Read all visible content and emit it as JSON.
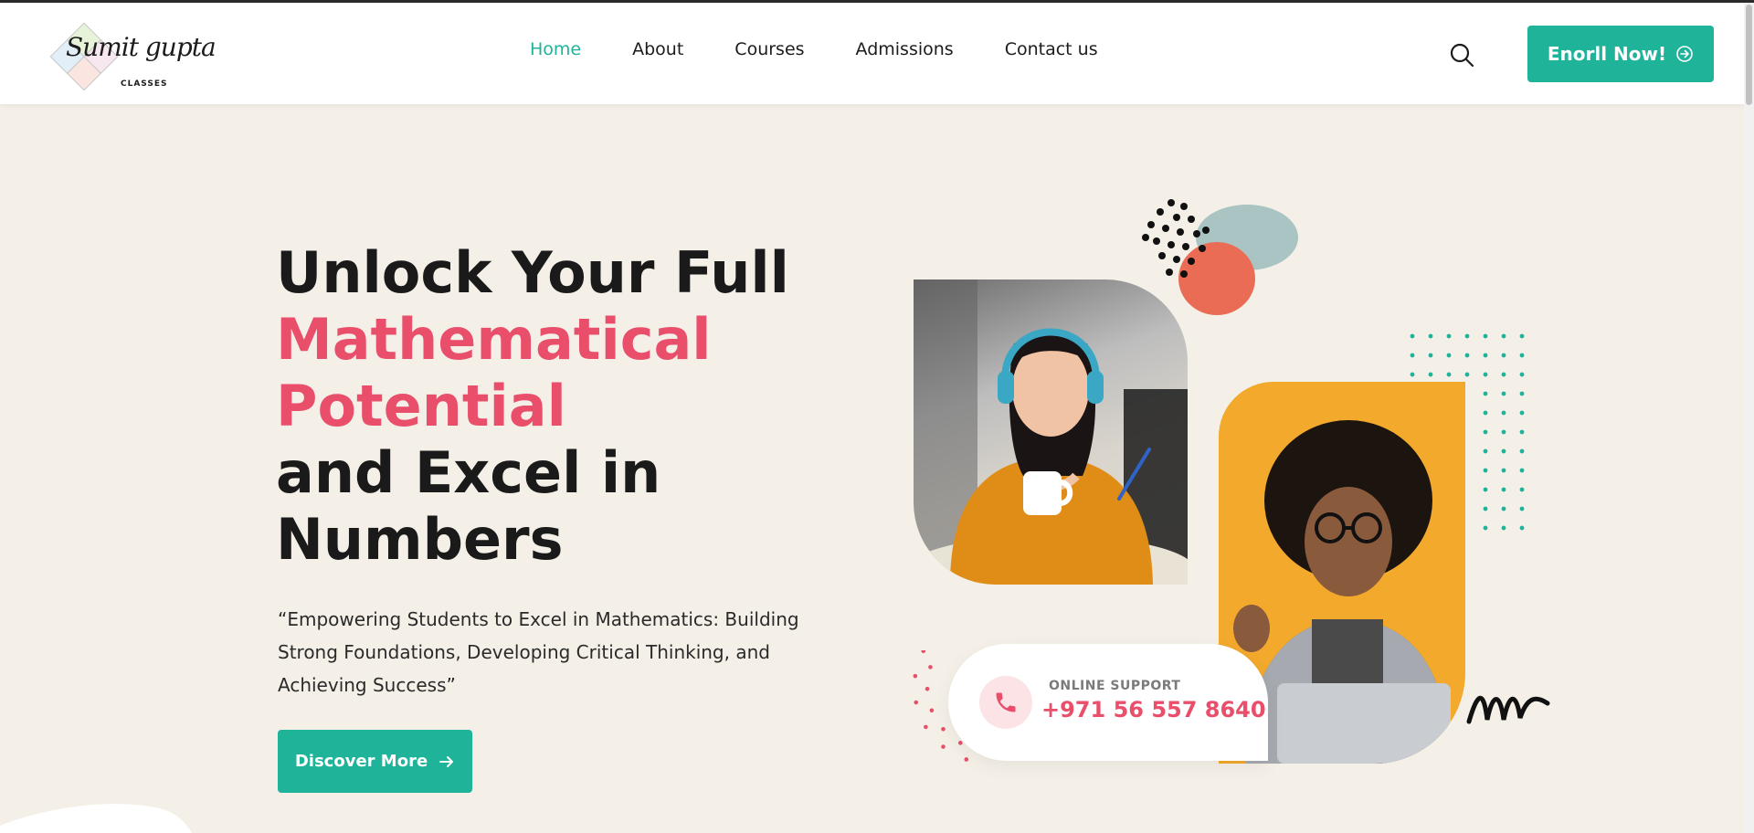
{
  "brand": {
    "logo_script": "Sumit gupta",
    "logo_sub": "CLASSES"
  },
  "nav": {
    "items": [
      {
        "label": "Home",
        "active": true
      },
      {
        "label": "About",
        "active": false
      },
      {
        "label": "Courses",
        "active": false
      },
      {
        "label": "Admissions",
        "active": false
      },
      {
        "label": "Contact us",
        "active": false
      }
    ]
  },
  "header": {
    "search_icon": "search-icon",
    "enroll_label": "Enorll Now!"
  },
  "hero": {
    "headline_line1": "Unlock Your Full",
    "headline_pink1": "Mathematical",
    "headline_pink2": "Potential",
    "headline_line3": "and Excel in",
    "headline_line4": "Numbers",
    "tagline": "“Empowering Students to Excel in Mathematics: Building Strong Foundations, Developing Critical Thinking, and Achieving Success”",
    "cta_label": "Discover More"
  },
  "support": {
    "label": "ONLINE SUPPORT",
    "phone": "+971 56 557 8640"
  },
  "colors": {
    "accent": "#1fb39a",
    "pink": "#e94f6b",
    "background": "#f4f0e8",
    "orange": "#f2a92c"
  }
}
